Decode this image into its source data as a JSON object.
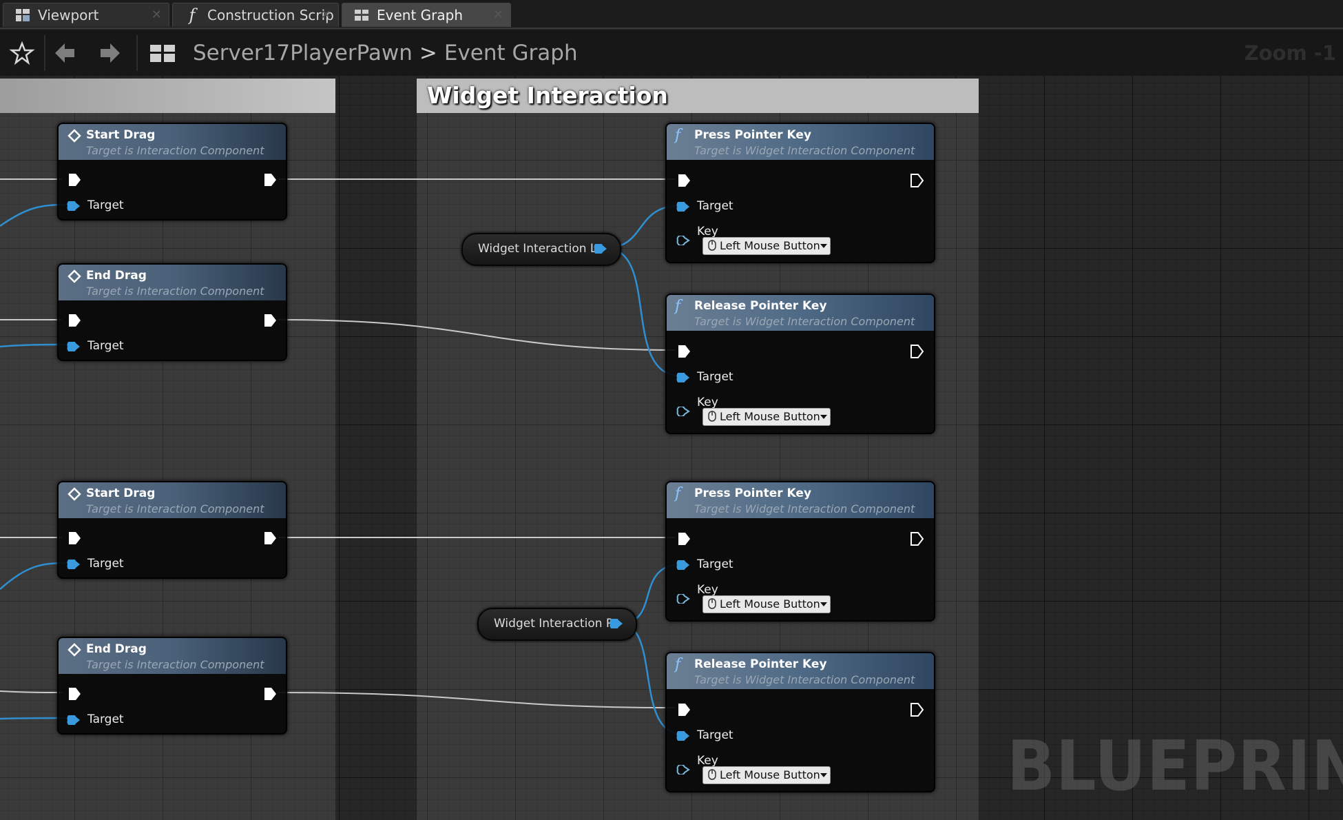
{
  "tabs": [
    {
      "label": "Viewport",
      "icon": "viewport-icon",
      "active": false
    },
    {
      "label": "Construction Scrip",
      "icon": "function-icon",
      "active": false
    },
    {
      "label": "Event Graph",
      "icon": "graph-icon",
      "active": true
    }
  ],
  "toolbar": {
    "breadcrumb_root": "Server17PlayerPawn",
    "breadcrumb_separator": ">",
    "breadcrumb_current": "Event Graph",
    "zoom": "Zoom -1"
  },
  "comment": {
    "title": "Widget Interaction"
  },
  "nodes": {
    "start_drag_1": {
      "title": "Start Drag",
      "subtitle": "Target is Interaction Component",
      "target": "Target"
    },
    "end_drag_1": {
      "title": "End Drag",
      "subtitle": "Target is Interaction Component",
      "target": "Target"
    },
    "start_drag_2": {
      "title": "Start Drag",
      "subtitle": "Target is Interaction Component",
      "target": "Target"
    },
    "end_drag_2": {
      "title": "End Drag",
      "subtitle": "Target is Interaction Component",
      "target": "Target"
    },
    "press_1": {
      "title": "Press Pointer Key",
      "subtitle": "Target is Widget Interaction Component",
      "target": "Target",
      "key": "Key",
      "key_value": "Left Mouse Button"
    },
    "release_1": {
      "title": "Release Pointer Key",
      "subtitle": "Target is Widget Interaction Component",
      "target": "Target",
      "key": "Key",
      "key_value": "Left Mouse Button"
    },
    "press_2": {
      "title": "Press Pointer Key",
      "subtitle": "Target is Widget Interaction Component",
      "target": "Target",
      "key": "Key",
      "key_value": "Left Mouse Button"
    },
    "release_2": {
      "title": "Release Pointer Key",
      "subtitle": "Target is Widget Interaction Component",
      "target": "Target",
      "key": "Key",
      "key_value": "Left Mouse Button"
    }
  },
  "variables": {
    "left": "Widget Interaction L",
    "right": "Widget Interaction R"
  },
  "watermark": "BLUEPRINT",
  "colors": {
    "exec_wire": "#c9c9c9",
    "object_wire": "#2f8fd1",
    "node_header": "#4f6a86"
  }
}
